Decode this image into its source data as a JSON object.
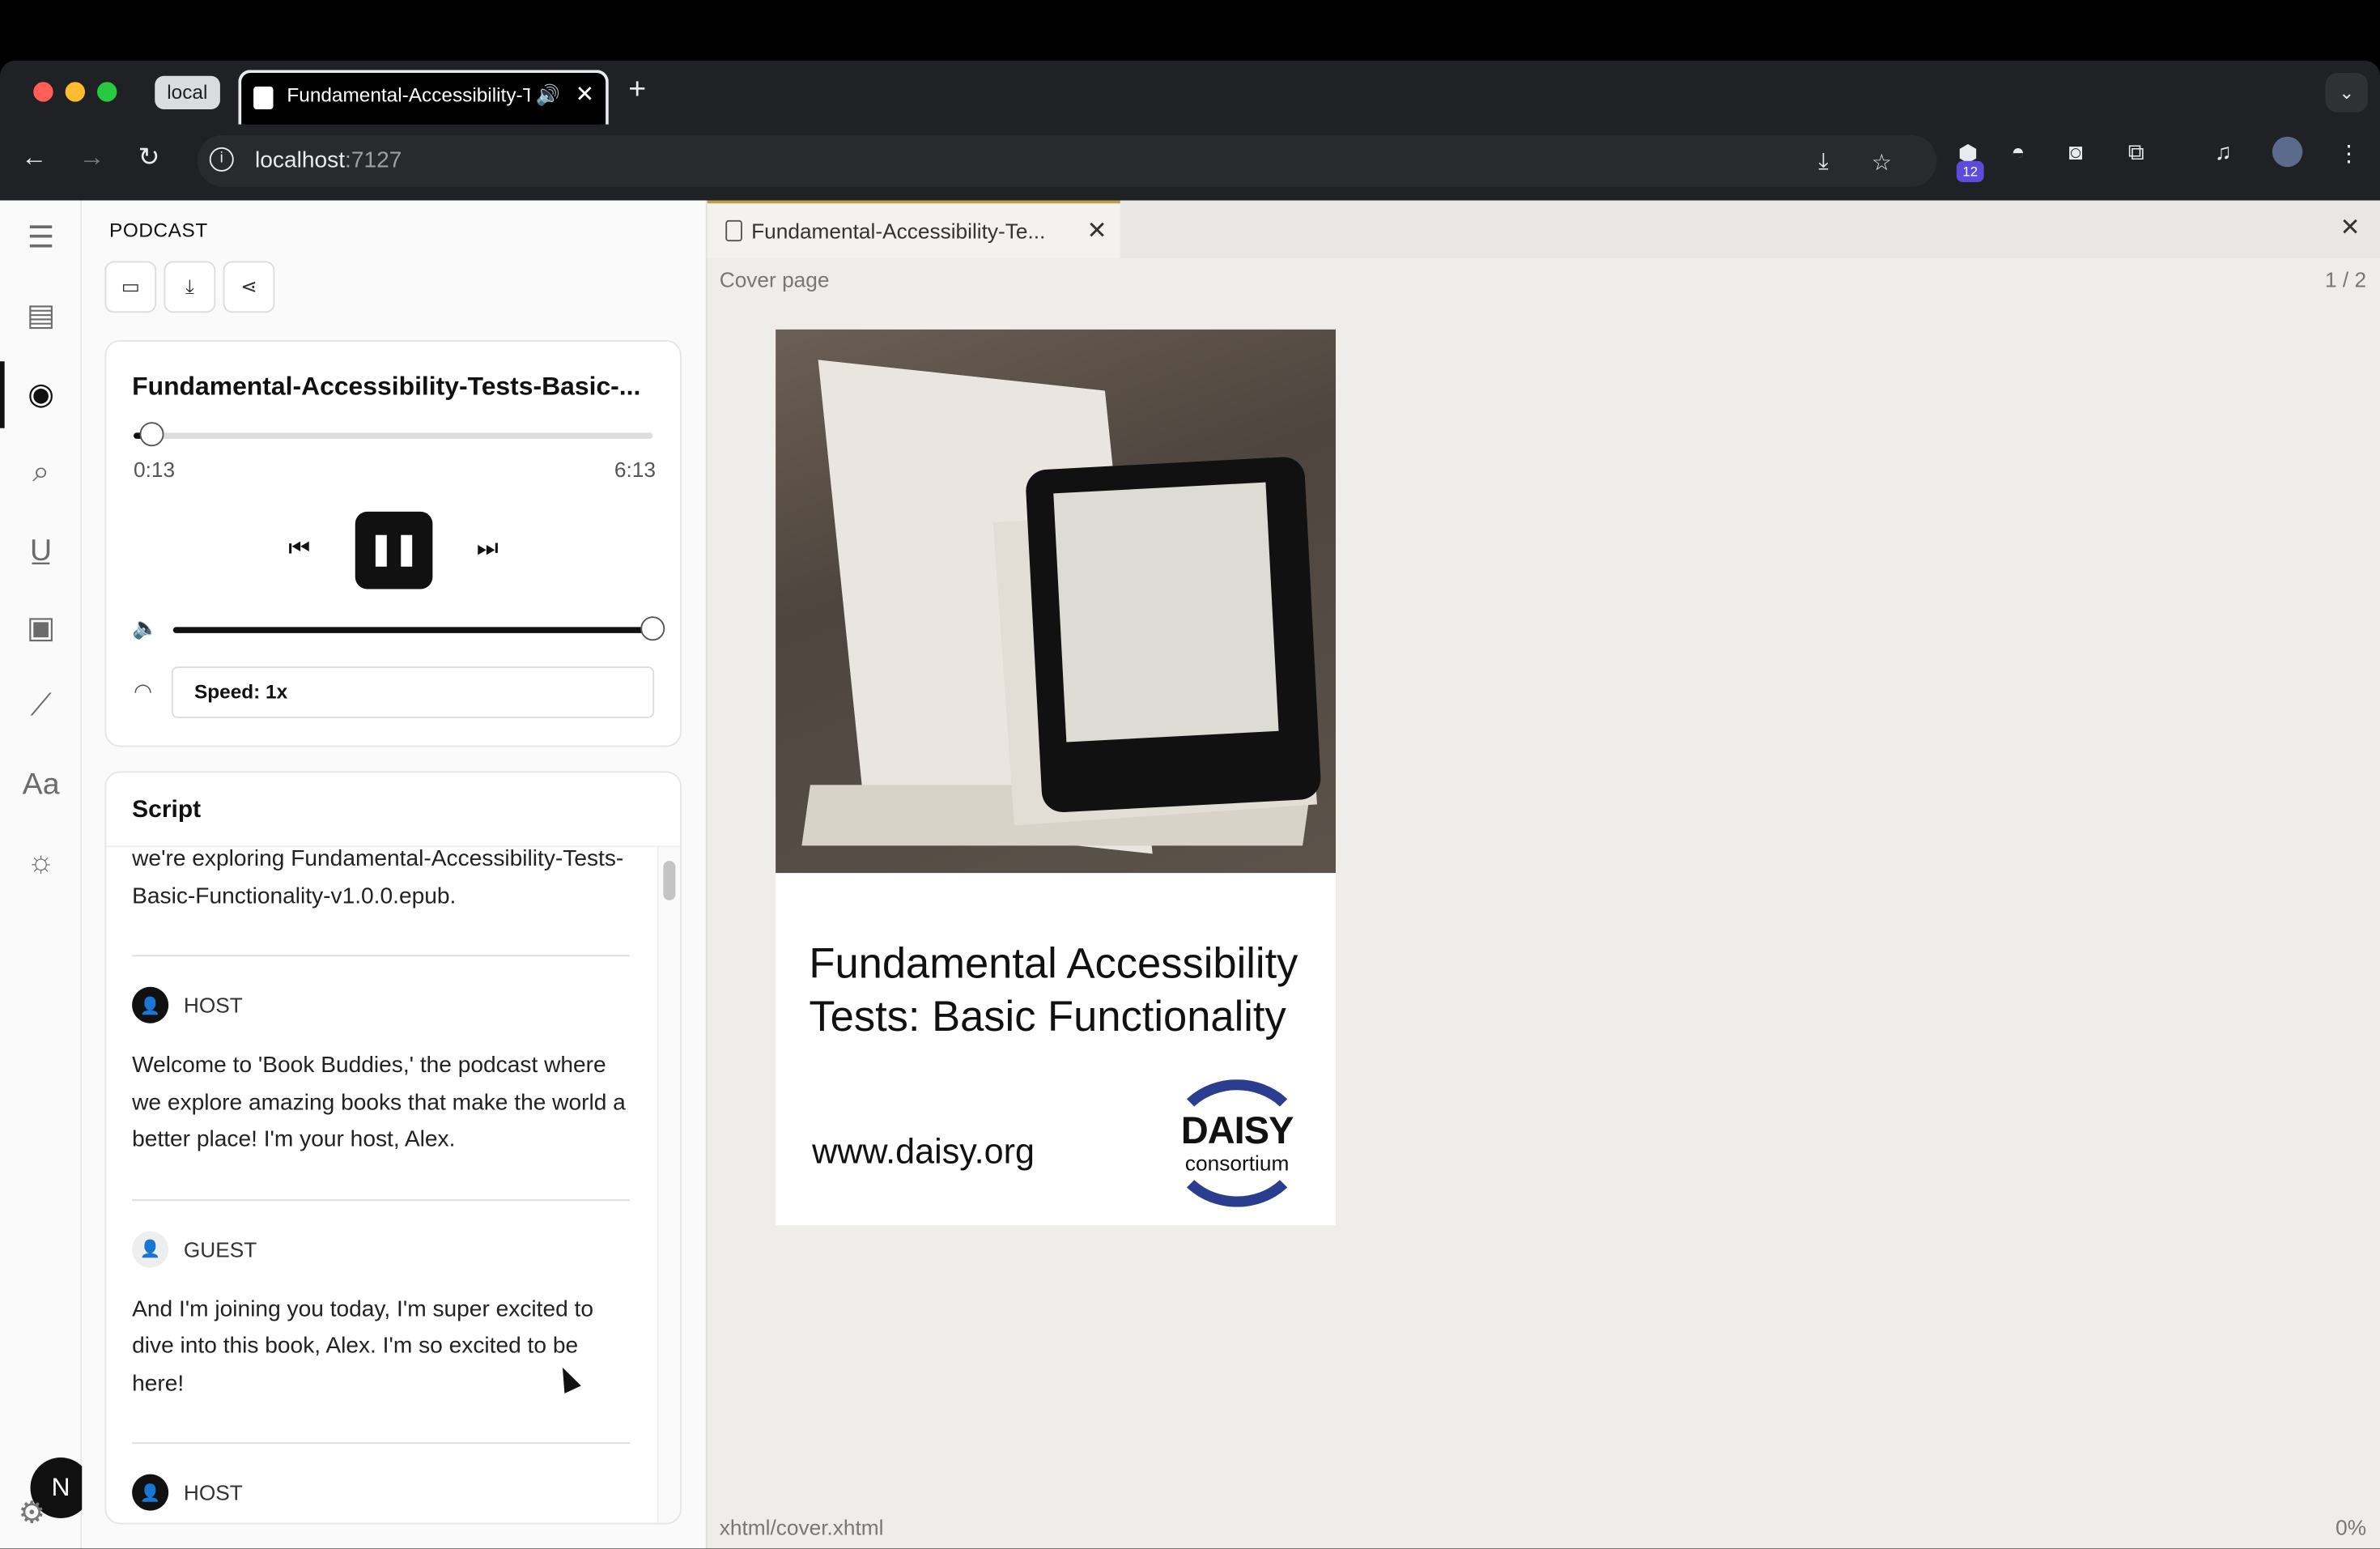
{
  "browser": {
    "profile_chip": "local",
    "tab_title": "Fundamental-Accessibility-Tests-Basic-Functionality",
    "new_tab": "+",
    "url_host": "localhost",
    "url_port": ":7127",
    "extension_badge": "12"
  },
  "sidebar_panel": {
    "title": "PODCAST"
  },
  "player": {
    "title": "Fundamental-Accessibility-Tests-Basic-...",
    "current_time": "0:13",
    "total_time": "6:13",
    "progress_fraction": 0.035,
    "volume_fraction": 1.0,
    "speed_label": "Speed: 1x",
    "play_state": "playing"
  },
  "script": {
    "heading": "Script",
    "lines": [
      {
        "speaker": "",
        "text": "we're exploring Fundamental-Accessibility-Tests-Basic-Functionality-v1.0.0.epub."
      },
      {
        "speaker": "HOST",
        "text": "Welcome to 'Book Buddies,' the podcast where we explore amazing books that make the world a better place! I'm your host, Alex."
      },
      {
        "speaker": "GUEST",
        "text": "And I'm joining you today, I'm super excited to dive into this book, Alex. I'm so excited to be here!"
      },
      {
        "speaker": "HOST",
        "text": ""
      }
    ]
  },
  "reader": {
    "tab_title": "Fundamental-Accessibility-Te...",
    "chapter": "Cover page",
    "page_count": "1 / 2",
    "cover_title": "Fundamental Accessibility Tests: Basic Functionality",
    "cover_url": "www.daisy.org",
    "logo_word": "DAISY",
    "logo_sub": "consortium",
    "file_path": "xhtml/cover.xhtml",
    "percent": "0%"
  },
  "user_avatar": "N"
}
